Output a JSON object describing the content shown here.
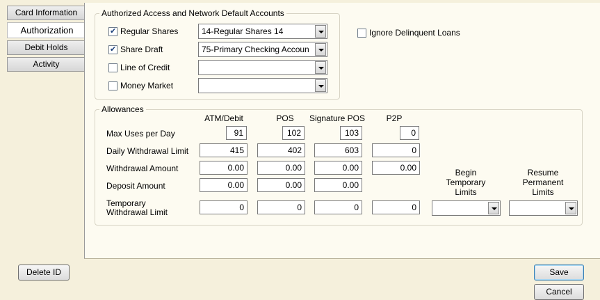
{
  "tabs": [
    "Card Information",
    "Authorization",
    "Debit Holds",
    "Activity"
  ],
  "accounts_group": {
    "title": "Authorized Access and Network Default Accounts",
    "rows": [
      {
        "label": "Regular Shares",
        "checked": true,
        "value": "14-Regular Shares 14"
      },
      {
        "label": "Share Draft",
        "checked": true,
        "value": "75-Primary Checking Accoun"
      },
      {
        "label": "Line of Credit",
        "checked": false,
        "value": ""
      },
      {
        "label": "Money Market",
        "checked": false,
        "value": ""
      }
    ]
  },
  "ignore_delinquent": {
    "label": "Ignore Delinquent Loans",
    "checked": false
  },
  "allowances": {
    "title": "Allowances",
    "columns": [
      "ATM/Debit",
      "POS",
      "Signature POS",
      "P2P"
    ],
    "rows": {
      "max_uses": {
        "label": "Max Uses per Day",
        "values": [
          "91",
          "102",
          "103",
          "0"
        ]
      },
      "daily_limit": {
        "label": "Daily Withdrawal Limit",
        "values": [
          "415",
          "402",
          "603",
          "0"
        ]
      },
      "withdrawal_amount": {
        "label": "Withdrawal Amount",
        "values": [
          "0.00",
          "0.00",
          "0.00",
          "0.00"
        ]
      },
      "deposit_amount": {
        "label": "Deposit Amount",
        "values": [
          "0.00",
          "0.00",
          "0.00"
        ]
      },
      "temp_limit": {
        "label_line1": "Temporary",
        "label_line2": "Withdrawal Limit",
        "values": [
          "0",
          "0",
          "0",
          "0"
        ]
      }
    },
    "begin_temporary": {
      "line1": "Begin",
      "line2": "Temporary",
      "line3": "Limits",
      "value": ""
    },
    "resume_permanent": {
      "line1": "Resume",
      "line2": "Permanent",
      "line3": "Limits",
      "value": ""
    }
  },
  "buttons": {
    "delete_id": "Delete ID",
    "save": "Save",
    "cancel": "Cancel"
  }
}
